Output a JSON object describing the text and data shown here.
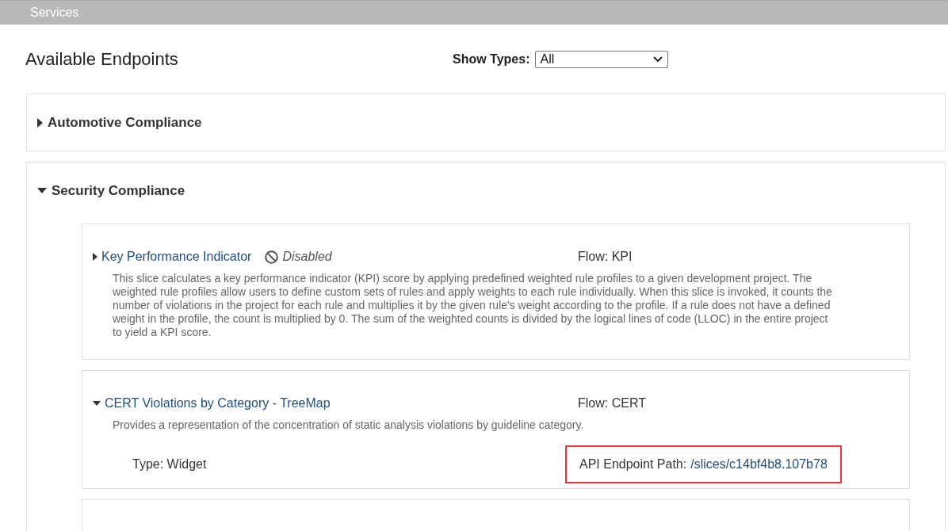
{
  "header": {
    "title": "Services"
  },
  "page_title": "Available Endpoints",
  "filter": {
    "label": "Show Types:",
    "value": "All"
  },
  "groups": [
    {
      "name": "Automotive Compliance",
      "expanded": false
    },
    {
      "name": "Security Compliance",
      "expanded": true,
      "slices": [
        {
          "name": "Key Performance Indicator",
          "expanded": false,
          "disabled": true,
          "disabled_label": "Disabled",
          "flow": "Flow: KPI",
          "description": "This slice calculates a key performance indicator (KPI) score by applying predefined weighted rule profiles to a given development project. The weighted rule profiles allow users to define custom sets of rules and apply weights to each rule individually. When this slice is invoked, it counts the number of violations in the project for each rule and multiplies it by the given rule's weight according to the profile. If a rule does not have a defined weight in the profile, the count is multiplied by 0. The sum of the weighted counts is divided by the logical lines of code (LLOC) in the entire project to yield a KPI score."
        },
        {
          "name": "CERT Violations by Category - TreeMap",
          "expanded": true,
          "disabled": false,
          "flow": "Flow: CERT",
          "description": "Provides a representation of the concentration of static analysis violations by guideline category.",
          "type": "Type: Widget",
          "api_label": "API Endpoint Path:",
          "api_path": "/slices/c14bf4b8.107b78",
          "highlighted": true
        }
      ]
    }
  ]
}
